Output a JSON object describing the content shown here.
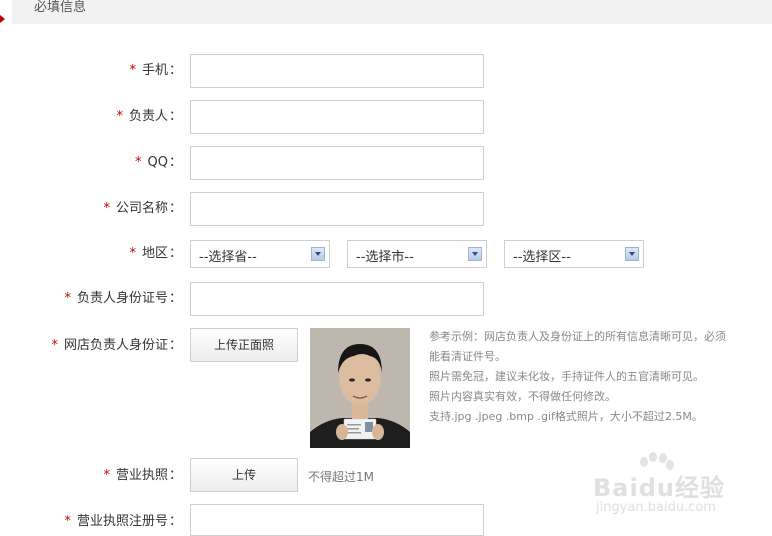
{
  "section": {
    "title": "必填信息"
  },
  "required_mark": "*",
  "colon": "：",
  "fields": {
    "phone": {
      "label": "手机",
      "value": ""
    },
    "owner": {
      "label": "负责人",
      "value": ""
    },
    "qq": {
      "label": "QQ",
      "value": ""
    },
    "company": {
      "label": "公司名称",
      "value": ""
    },
    "region": {
      "label": "地区",
      "province": "--选择省--",
      "city": "--选择市--",
      "district": "--选择区--"
    },
    "owner_id": {
      "label": "负责人身份证号",
      "value": ""
    },
    "shop_owner_id": {
      "label": "网店负责人身份证",
      "upload_label": "上传正面照"
    },
    "license": {
      "label": "营业执照",
      "upload_label": "上传",
      "note": "不得超过1M"
    },
    "license_no": {
      "label": "营业执照注册号",
      "value": ""
    }
  },
  "hints": [
    "参考示例：网店负责人及身份证上的所有信息清晰可见，必须",
    "能看清证件号。",
    "照片需免冠，建议未化妆，手持证件人的五官清晰可见。",
    "照片内容真实有效，不得做任何修改。",
    "支持.jpg .jpeg .bmp .gif格式照片，大小不超过2.5M。"
  ],
  "watermark": {
    "logo": "Baidu经验",
    "url": "jingyan.baidu.com"
  },
  "colors": {
    "required": "#c00000",
    "header_bg": "#f2f2f2",
    "border": "#cfcfcf"
  }
}
